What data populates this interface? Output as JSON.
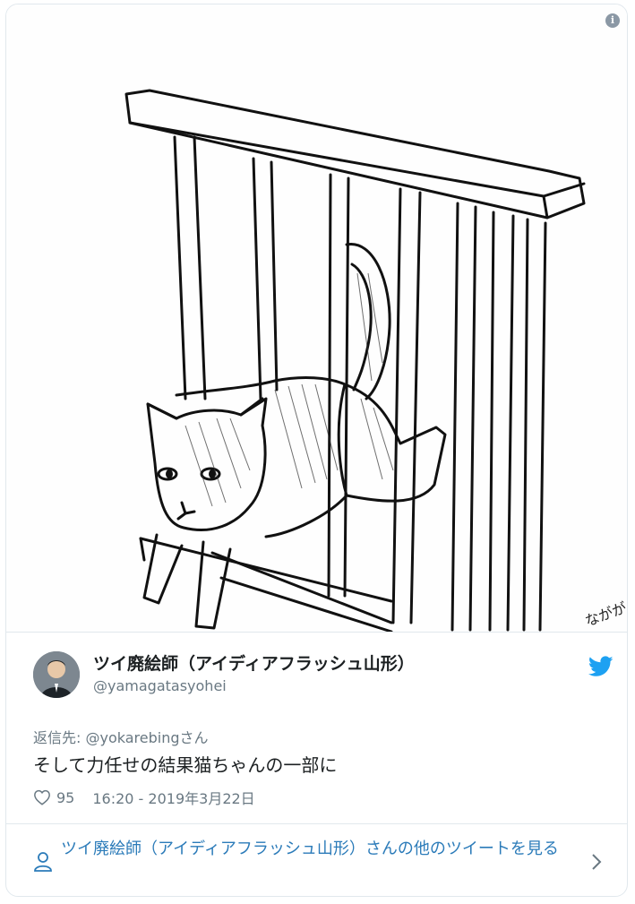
{
  "tweet": {
    "author": {
      "display_name": "ツイ廃絵師（アイディアフラッシュ山形）",
      "handle": "@yamagatasyohei",
      "avatar_icon": "user-avatar"
    },
    "reply_to": {
      "prefix": "返信先: ",
      "mention": "@yokarebing",
      "suffix": "さん"
    },
    "text": "そして力任せの結果猫ちゃんの一部に",
    "likes": "95",
    "timestamp": "16:20 - 2019年3月22日",
    "more_tweets_label": "ツイ廃絵師（アイディアフラッシュ山形）さんの他のツイートを見る",
    "media": {
      "description_icon": "info-icon",
      "signature": "ながが"
    }
  },
  "colors": {
    "link": "#2b7bb9",
    "muted": "#697882",
    "twitter_blue": "#1da1f2",
    "border": "#e1e8ed"
  }
}
